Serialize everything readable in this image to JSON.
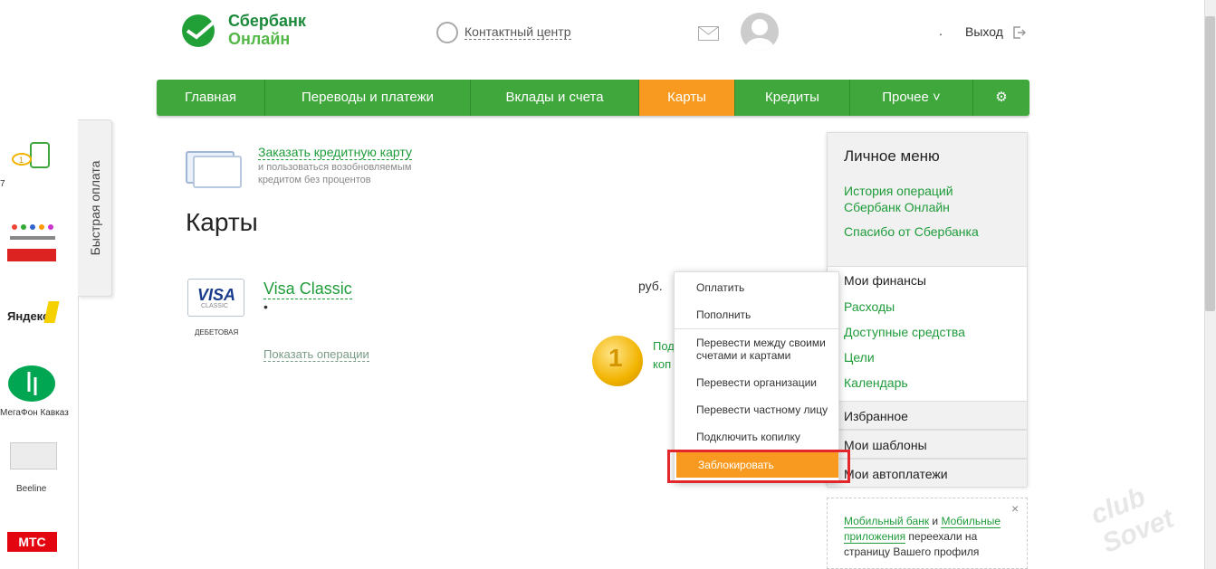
{
  "header": {
    "logo_line1": "Сбербанк",
    "logo_line2": "Онлайн",
    "contact_center": "Контактный центр",
    "user_dot": ".",
    "logout": "Выход"
  },
  "nav": {
    "items": [
      "Главная",
      "Переводы и платежи",
      "Вклады и счета",
      "Карты",
      "Кредиты",
      "Прочее ˅"
    ],
    "active": "Карты"
  },
  "quick_pay": {
    "tab_label": "Быстрая оплата",
    "items": [
      "7",
      "",
      "Яндекс",
      "МегаФон Кавказ",
      "Beeline",
      "МТС"
    ]
  },
  "main": {
    "order_card_link": "Заказать кредитную карту",
    "order_card_desc": "и пользоваться возобновляемым кредитом без процентов",
    "page_title": "Карты",
    "card": {
      "brand": "VISA",
      "brand_sub": "CLASSIC",
      "type": "ДЕБЕТОВАЯ",
      "name": "Visa Classic",
      "number": "•",
      "show_operations": "Показать операции",
      "currency": "руб."
    },
    "coin": {
      "number": "1",
      "line1": "Под",
      "line2": "коп"
    }
  },
  "dropdown": {
    "items": [
      "Оплатить",
      "Пополнить",
      "Перевести между своими счетами и картами",
      "Перевести организации",
      "Перевести частному лицу",
      "Подключить копилку",
      "Заблокировать"
    ],
    "highlighted": "Заблокировать"
  },
  "personal_menu": {
    "title": "Личное меню",
    "links": [
      "История операций Сбербанк Онлайн",
      "Спасибо от Сбербанка"
    ],
    "finances_title": "Мои финансы",
    "finance_links": [
      "Расходы",
      "Доступные средства",
      "Цели",
      "Календарь"
    ],
    "sections": [
      "Избранное",
      "Мои шаблоны",
      "Мои автоплатежи"
    ]
  },
  "notice": {
    "link1": "Мобильный банк",
    "mid": " и ",
    "link2": "Мобильные приложения",
    "tail": " переехали на страницу Вашего профиля",
    "close": "×"
  },
  "watermark": "club Sovet",
  "colors": {
    "green": "#3fa73c",
    "orange": "#f79a1f",
    "link": "#1f9c3a",
    "highlight_frame": "#e3262b"
  }
}
